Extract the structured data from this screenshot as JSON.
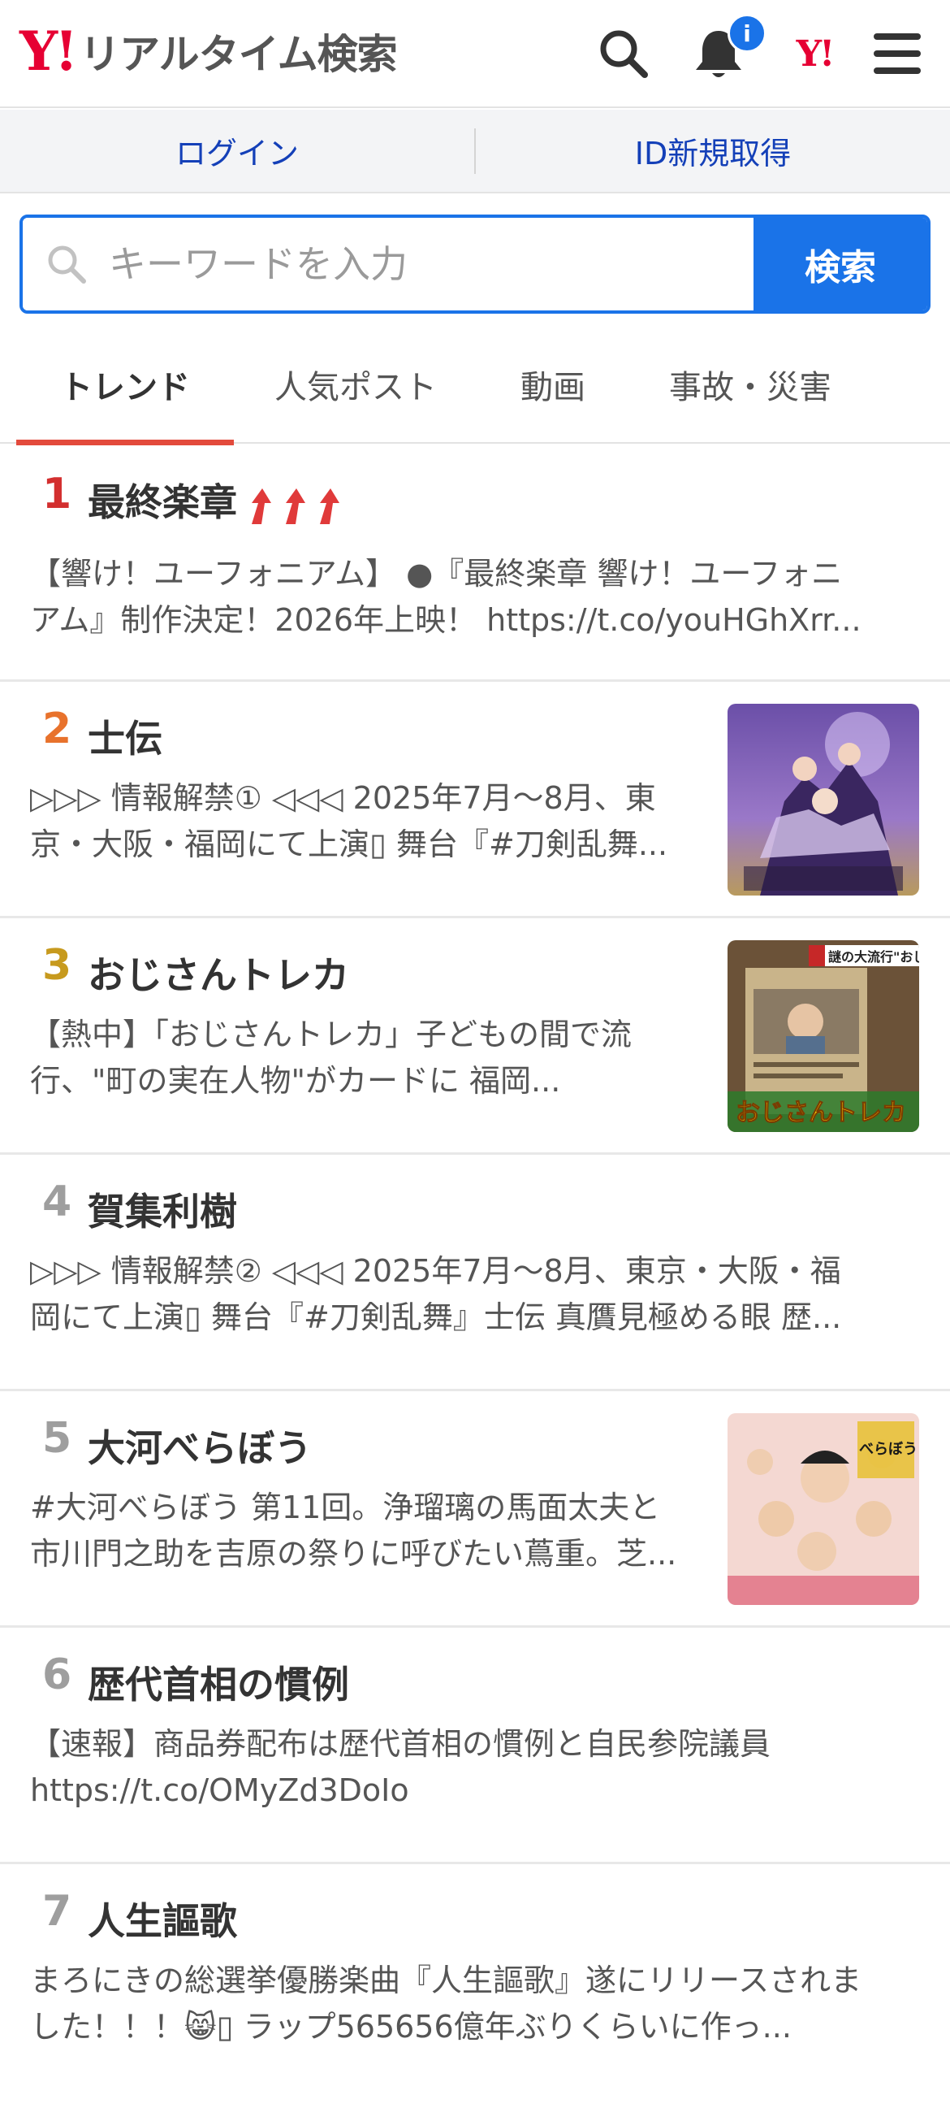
{
  "header": {
    "logo_mark": "Y!",
    "logo_text": "リアルタイム検索",
    "notification_badge": "i",
    "yj_mark": "Y!"
  },
  "login": {
    "login_label": "ログイン",
    "register_label": "ID新規取得"
  },
  "search": {
    "placeholder": "キーワードを入力",
    "button_label": "検索"
  },
  "tabs": [
    {
      "label": "トレンド",
      "active": true
    },
    {
      "label": "人気ポスト",
      "active": false
    },
    {
      "label": "動画",
      "active": false
    },
    {
      "label": "事故・災害",
      "active": false
    }
  ],
  "trends": [
    {
      "rank": "1",
      "rank_color": "#d32f2f",
      "title": "最終楽章",
      "rising": true,
      "desc1": "【響け！ユーフォニアム】 ●『最終楽章 響け！ユーフォニ",
      "desc2": "アム』制作決定！2026年上映！ https://t.co/youHGhXrr..."
    },
    {
      "rank": "2",
      "rank_color": "#e8722c",
      "title": "士伝",
      "thumb": "stage-poster",
      "desc1": "▷▷▷ 情報解禁① ◁◁◁ 2025年7月〜8月、東",
      "desc2": "京・大阪・福岡にて上演▯ 舞台『#刀剣乱舞..."
    },
    {
      "rank": "3",
      "rank_color": "#c79a1e",
      "title": "おじさんトレカ",
      "thumb": "trading-card",
      "desc1": "【熱中】「おじさんトレカ」子どもの間で流",
      "desc2": "行、\"町の実在人物\"がカードに 福岡..."
    },
    {
      "rank": "4",
      "rank_color": "#9e9e9e",
      "title": "賀集利樹",
      "desc1": "▷▷▷ 情報解禁② ◁◁◁ 2025年7月〜8月、東京・大阪・福",
      "desc2": "岡にて上演▯ 舞台『#刀剣乱舞』士伝 真贋見極める眼 歴..."
    },
    {
      "rank": "5",
      "rank_color": "#9e9e9e",
      "title": "大河べらぼう",
      "thumb": "drama-poster",
      "desc1": "#大河べらぼう 第11回。浄瑠璃の馬面太夫と",
      "desc2": "市川門之助を吉原の祭りに呼びたい蔦重。芝..."
    },
    {
      "rank": "6",
      "rank_color": "#9e9e9e",
      "title": "歴代首相の慣例",
      "desc1": "【速報】商品券配布は歴代首相の慣例と自民参院議員",
      "desc2": "https://t.co/OMyZd3DoIo"
    },
    {
      "rank": "7",
      "rank_color": "#9e9e9e",
      "title": "人生謳歌",
      "desc1": "まろにきの総選挙優勝楽曲『人生謳歌』遂にリリースされま",
      "desc2": "した！！！😸▯ ラップ565656億年ぶりくらいに作っ..."
    }
  ],
  "thumb_captions": {
    "card_banner": "謎の大流行\"おじ",
    "card_label": "おじさんトレカ",
    "drama_title": "べらぼう"
  },
  "colors": {
    "accent_blue": "#1a73e8",
    "link_blue": "#1440b8",
    "tab_underline": "#e34a3c",
    "brand_red": "#e60033"
  }
}
